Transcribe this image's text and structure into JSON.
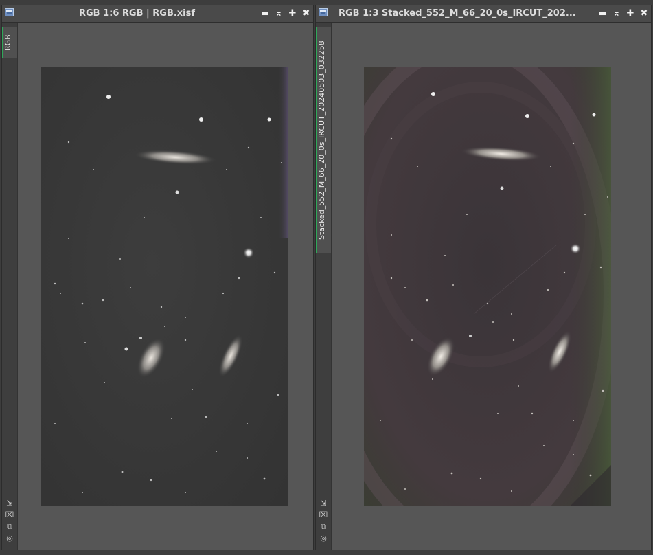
{
  "colors": {
    "desktop": "#3d3d3d",
    "window": "#565656",
    "titlebar": "#4a4a4a",
    "tab_accent": "#2fa85a"
  },
  "windows": [
    {
      "title": "RGB 1:6 RGB | RGB.xisf",
      "tab_label": "RGB",
      "controls": [
        "minimize-icon",
        "shade-icon",
        "maximize-icon",
        "close-icon"
      ],
      "control_glyphs": [
        "▬",
        "⌅",
        "✚",
        "✖"
      ],
      "side_icons": [
        "fit-view-icon",
        "zoom-icon",
        "clone-icon",
        "target-icon"
      ],
      "image": {
        "description_hint": "linear stretched astrophoto, neutral gray background"
      }
    },
    {
      "title": "RGB 1:3 Stacked_552_M_66_20_0s_IRCUT_202...",
      "tab_label": "Stacked_552_M_66_20_0s_IRCUT_20240503_032258",
      "controls": [
        "minimize-icon",
        "shade-icon",
        "maximize-icon",
        "close-icon"
      ],
      "control_glyphs": [
        "▬",
        "⌅",
        "✚",
        "✖"
      ],
      "side_icons": [
        "fit-view-icon",
        "zoom-icon",
        "clone-icon",
        "target-icon"
      ],
      "image": {
        "description_hint": "stacked astrophoto with gradients and color noise"
      }
    }
  ]
}
